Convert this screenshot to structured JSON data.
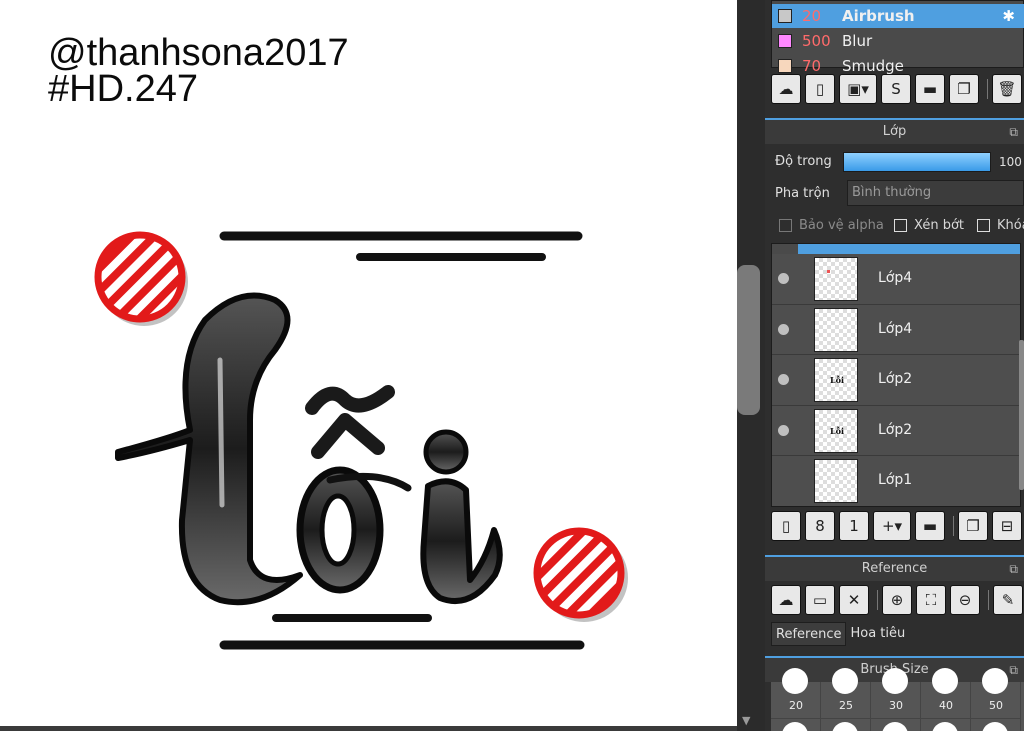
{
  "canvas": {
    "watermark_line1": "@thanhsona2017",
    "watermark_line2": "#HD.247",
    "artwork_text": "Lỗi"
  },
  "brushes": [
    {
      "size": "20",
      "name": "Airbrush",
      "color": "#c8c8c8",
      "selected": true
    },
    {
      "size": "500",
      "name": "Blur",
      "color": "#ff88ff",
      "selected": false
    },
    {
      "size": "70",
      "name": "Smudge",
      "color": "#f7d7bd",
      "selected": false
    }
  ],
  "layer_panel": {
    "title": "Lớp",
    "opacity_label": "Độ trong",
    "opacity_value": "100",
    "opacity": 1.0,
    "blend_label": "Pha trộn",
    "blend_value": "Bình thường",
    "protect_alpha": "Bảo vệ alpha",
    "clipping": "Xén bớt",
    "lock": "Khóa",
    "layers": [
      {
        "name": "Lớp4",
        "visible": true
      },
      {
        "name": "Lớp4",
        "visible": true
      },
      {
        "name": "Lớp2",
        "visible": true
      },
      {
        "name": "Lớp2",
        "visible": true
      },
      {
        "name": "Lớp1",
        "visible": false
      }
    ]
  },
  "reference_panel": {
    "title": "Reference",
    "tab_reference": "Reference",
    "tab_navigator": "Hoa tiêu"
  },
  "brush_size_panel": {
    "title": "Brush Size",
    "sizes": [
      "20",
      "25",
      "30",
      "40",
      "50"
    ]
  },
  "colors": {
    "accent": "#4f9fe0",
    "panel_bg": "#2e2e2e",
    "forbidden_red": "#e21a1a"
  }
}
